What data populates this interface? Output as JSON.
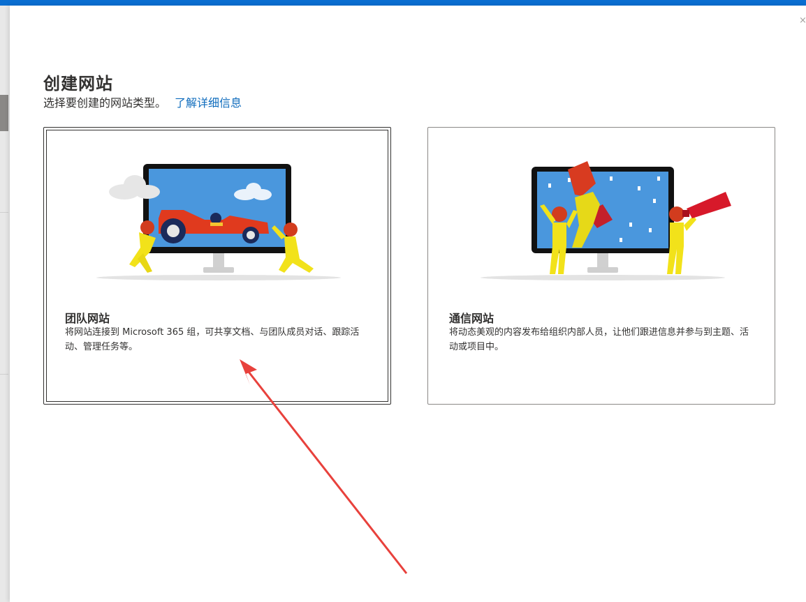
{
  "dialog": {
    "title": "创建网站",
    "subtitle": "选择要创建的网站类型。",
    "learn_more_link": "了解详细信息",
    "close_glyph": "×"
  },
  "cards": [
    {
      "title": "团队网站",
      "description": "将网站连接到 Microsoft 365 组，可共享文档、与团队成员对话、跟踪活动、管理任务等。",
      "illustration_icon": "race-car-pit-crew-illustration",
      "selected": true
    },
    {
      "title": "通信网站",
      "description": "将动态美观的内容发布给组织内部人员，让他们跟进信息并参与到主题、活动或项目中。",
      "illustration_icon": "trophy-megaphone-illustration",
      "selected": false
    }
  ],
  "colors": {
    "accent_bar": "#0a6ed1",
    "link": "#0f6cbd",
    "annotation_arrow": "#e8413c"
  }
}
